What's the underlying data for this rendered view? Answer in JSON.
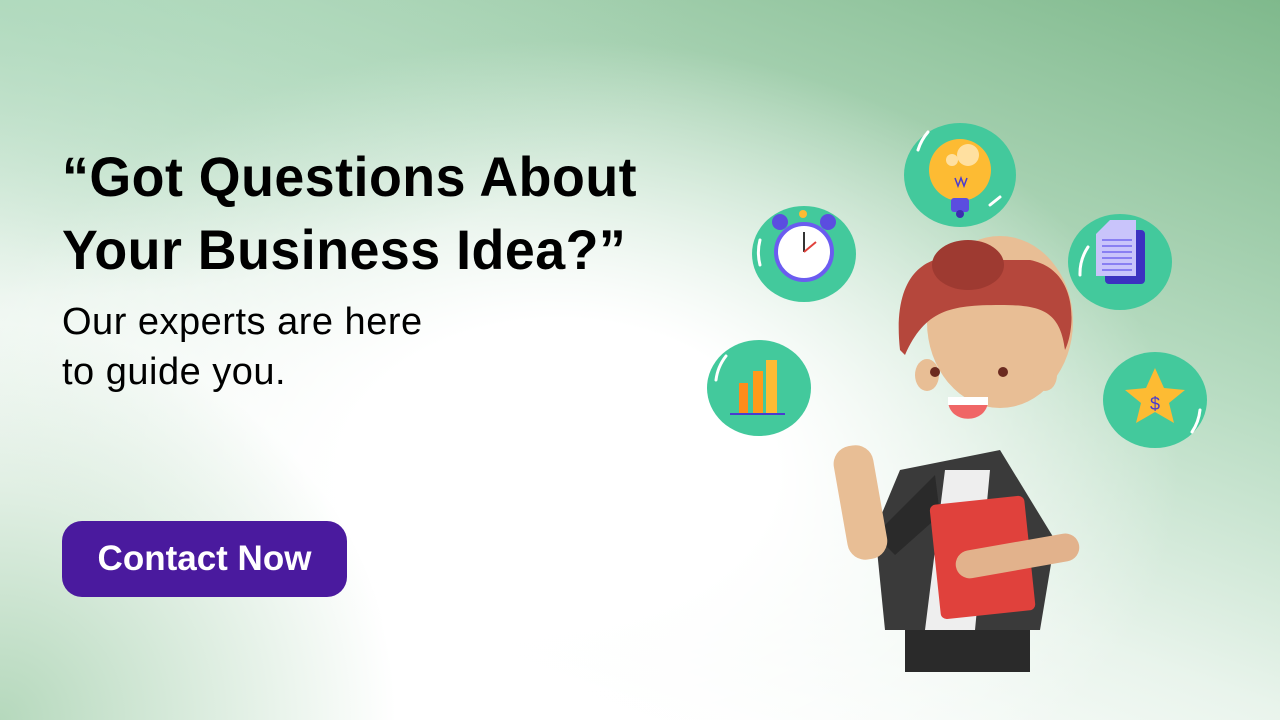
{
  "headline": {
    "line1": "“Got Questions About",
    "line2": "Your Business Idea?”"
  },
  "subtext": {
    "line1": "Our experts are here",
    "line2": "to guide you."
  },
  "cta": {
    "label": "Contact Now"
  },
  "colors": {
    "button": "#4a1a9e",
    "icon_circle": "#43c99c",
    "hair": "#b5473c",
    "folder": "#e0413c"
  },
  "icons": [
    "lightbulb-icon",
    "alarm-clock-icon",
    "document-icon",
    "bar-chart-icon",
    "star-dollar-icon"
  ],
  "currency_symbol": "$"
}
